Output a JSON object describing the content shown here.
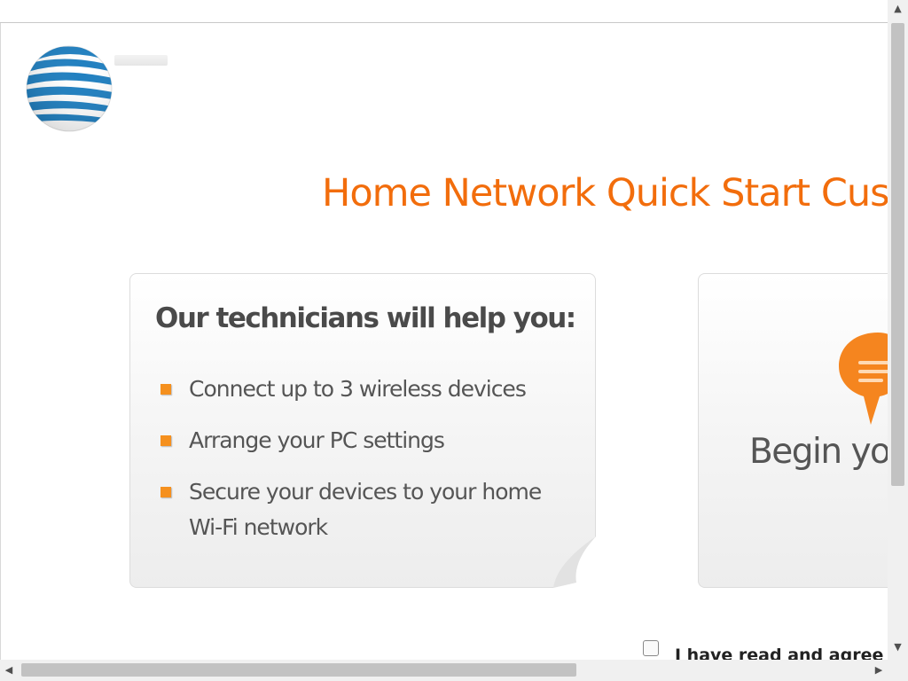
{
  "header": {
    "logo_icon": "att-globe-logo",
    "title": "Home Network Quick Start Cus"
  },
  "left_card": {
    "heading": "Our technicians will help you:",
    "items": [
      {
        "label": "Connect up to 3 wireless devices"
      },
      {
        "label": "Arrange your PC settings"
      },
      {
        "label": "Secure your devices to your home Wi-Fi network"
      }
    ]
  },
  "right_card": {
    "icon": "chat-bubble-icon",
    "label": "Begin you"
  },
  "terms": {
    "label": "I have read and agree"
  },
  "colors": {
    "accent": "#f26d0c",
    "bullet": "#f5901e",
    "globe_blue": "#1f7fc0"
  }
}
